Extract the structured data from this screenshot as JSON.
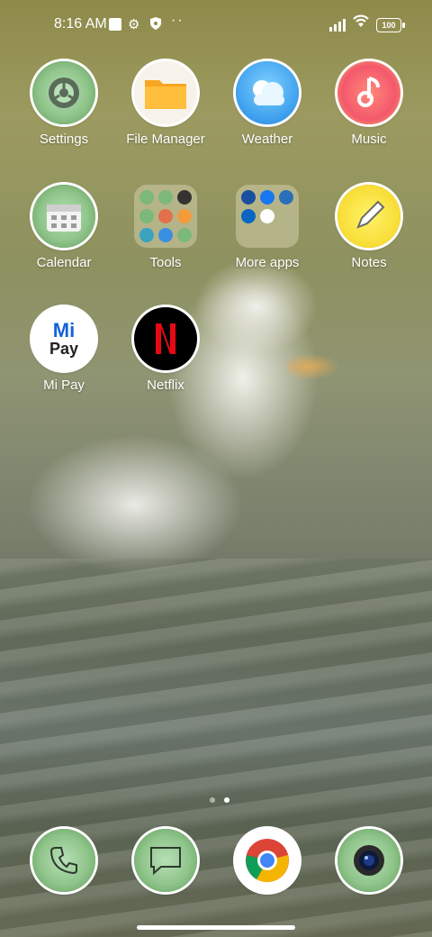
{
  "status_bar": {
    "time": "8:16 AM",
    "battery": "100"
  },
  "apps": [
    {
      "label": "Settings",
      "icon": "settings-icon"
    },
    {
      "label": "File Manager",
      "icon": "folder-icon"
    },
    {
      "label": "Weather",
      "icon": "weather-icon"
    },
    {
      "label": "Music",
      "icon": "music-icon"
    },
    {
      "label": "Calendar",
      "icon": "calendar-icon"
    },
    {
      "label": "Tools",
      "icon": "folder-icon"
    },
    {
      "label": "More apps",
      "icon": "folder-icon"
    },
    {
      "label": "Notes",
      "icon": "notes-icon"
    },
    {
      "label": "Mi Pay",
      "icon": "mipay-icon"
    },
    {
      "label": "Netflix",
      "icon": "netflix-icon"
    }
  ],
  "mipay_text": {
    "top": "Mi",
    "bottom": "Pay"
  },
  "dock": [
    {
      "name": "Phone",
      "icon": "phone-icon"
    },
    {
      "name": "Messages",
      "icon": "messages-icon"
    },
    {
      "name": "Chrome",
      "icon": "chrome-icon"
    },
    {
      "name": "Camera",
      "icon": "camera-icon"
    }
  ],
  "pager": {
    "pages": 2,
    "current": 2
  },
  "colors": {
    "icon_bg_green": "#8fc48a",
    "netflix_red": "#e50914",
    "accent_white": "#ffffff"
  }
}
